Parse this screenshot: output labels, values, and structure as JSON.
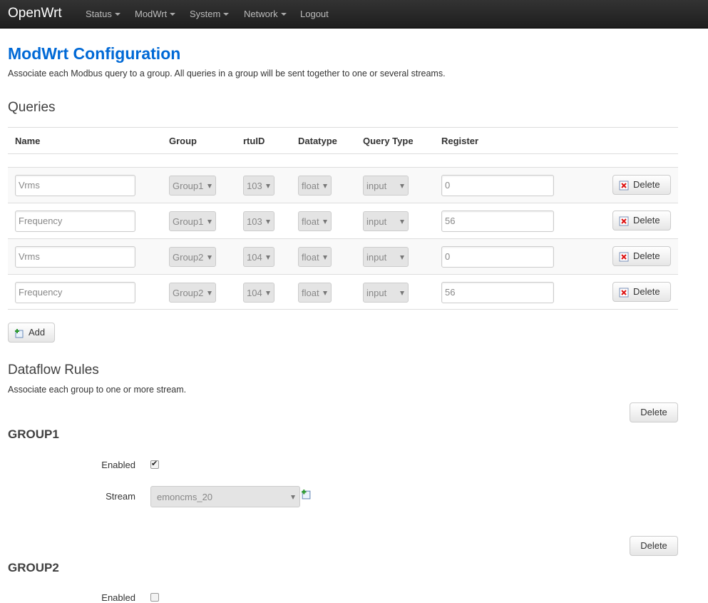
{
  "navbar": {
    "brand": "OpenWrt",
    "menu": [
      {
        "label": "Status",
        "dropdown": true
      },
      {
        "label": "ModWrt",
        "dropdown": true
      },
      {
        "label": "System",
        "dropdown": true
      },
      {
        "label": "Network",
        "dropdown": true
      },
      {
        "label": "Logout",
        "dropdown": false
      }
    ]
  },
  "page": {
    "title": "ModWrt Configuration",
    "description": "Associate each Modbus query to a group. All queries in a group will be sent together to one or several streams."
  },
  "queries": {
    "title": "Queries",
    "columns": [
      "Name",
      "Group",
      "rtuID",
      "Datatype",
      "Query Type",
      "Register"
    ],
    "rows": [
      {
        "name": "Vrms",
        "group": "Group1",
        "rtu_id": "103",
        "datatype": "float",
        "query_type": "input",
        "register": "0",
        "delete_label": "Delete"
      },
      {
        "name": "Frequency",
        "group": "Group1",
        "rtu_id": "103",
        "datatype": "float",
        "query_type": "input",
        "register": "56",
        "delete_label": "Delete"
      },
      {
        "name": "Vrms",
        "group": "Group2",
        "rtu_id": "104",
        "datatype": "float",
        "query_type": "input",
        "register": "0",
        "delete_label": "Delete"
      },
      {
        "name": "Frequency",
        "group": "Group2",
        "rtu_id": "104",
        "datatype": "float",
        "query_type": "input",
        "register": "56",
        "delete_label": "Delete"
      }
    ],
    "add_label": "Add"
  },
  "dataflow": {
    "title": "Dataflow Rules",
    "description": "Associate each group to one or more stream.",
    "groups": [
      {
        "title": "GROUP1",
        "delete_label": "Delete",
        "enabled_label": "Enabled",
        "enabled": true,
        "stream_label": "Stream",
        "stream_value": "emoncms_20"
      },
      {
        "title": "GROUP2",
        "delete_label": "Delete",
        "enabled_label": "Enabled",
        "enabled": false
      }
    ]
  },
  "colors": {
    "accent": "#0069d6",
    "navbar": "#222222"
  }
}
